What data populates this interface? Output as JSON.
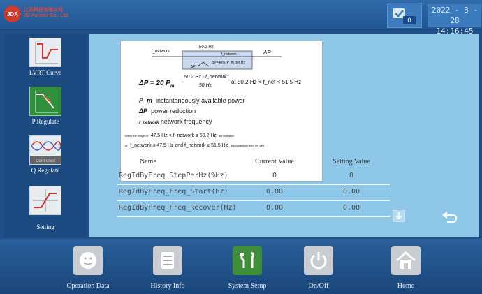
{
  "header": {
    "logo_text": "JDA",
    "company_line1": "江苏科技有限公司",
    "company_line2": "JD Access Co., Ltd.",
    "alarm_count": "0",
    "date": "2022 - 3 - 28",
    "time": "14:16:45"
  },
  "sidebar": {
    "items": [
      {
        "label": "LVRT Curve",
        "icon": "lvrt-curve-icon"
      },
      {
        "label": "P Regulate",
        "icon": "p-regulate-icon"
      },
      {
        "label": "Q Regulate",
        "icon": "q-regulate-icon",
        "caption": "Controlled"
      },
      {
        "label": "Setting",
        "icon": "setting-curve-icon"
      }
    ]
  },
  "diagram": {
    "block_in": "f_network",
    "block_top": "50.2 Hz",
    "block_mid": "f_network",
    "block_arrow_label": "ΔP=40%*P_m per Hz",
    "block_out": "ΔP",
    "block_bottom": "ΔP",
    "formula_lhs": "ΔP = 20 P",
    "formula_sub": "m",
    "formula_num": "50.2 Hz  -  f_network",
    "formula_den": "50 Hz",
    "formula_cond": "at 50.2 Hz  < f_net  < 51.5 Hz",
    "def1_sym": "P_m",
    "def1_text": "instantaneously available power",
    "def2_sym": "ΔP",
    "def2_text": "power reduction",
    "def3_sym": "f_network",
    "def3_text": "network frequency",
    "range1_prefix": "within the range of",
    "range1": "47.5 Hz  <  f_network ≤  50.2 Hz",
    "range1_note": "no limitation",
    "range2_prefix": "at",
    "range2": "f_network ≤ 47.5 Hz and f_network ≥ 51.5 Hz",
    "range2_note": "disconnection from the grid"
  },
  "table": {
    "headers": [
      "Name",
      "Current Value",
      "Setting Value"
    ],
    "rows": [
      {
        "name": "RegIdByFreq_StepPerHz(%Hz)",
        "current": "0",
        "setting": "0"
      },
      {
        "name": "RegIdByFreq_Freq_Start(Hz)",
        "current": "0.00",
        "setting": "0.00"
      },
      {
        "name": "RegIdByFreq_Freq_Recover(Hz)",
        "current": "0.00",
        "setting": "0.00"
      }
    ]
  },
  "nav": {
    "items": [
      {
        "label": "Operation Data",
        "icon": "smiley-icon"
      },
      {
        "label": "History Info",
        "icon": "list-icon"
      },
      {
        "label": "System Setup",
        "icon": "tools-icon"
      },
      {
        "label": "On/Off",
        "icon": "power-icon"
      },
      {
        "label": "Home",
        "icon": "home-icon"
      }
    ]
  },
  "colors": {
    "background": "#1f4f86",
    "panel": "#8fc7e8",
    "active_tab": "#2f8f3a",
    "nav_active": "#3f8f3a"
  }
}
